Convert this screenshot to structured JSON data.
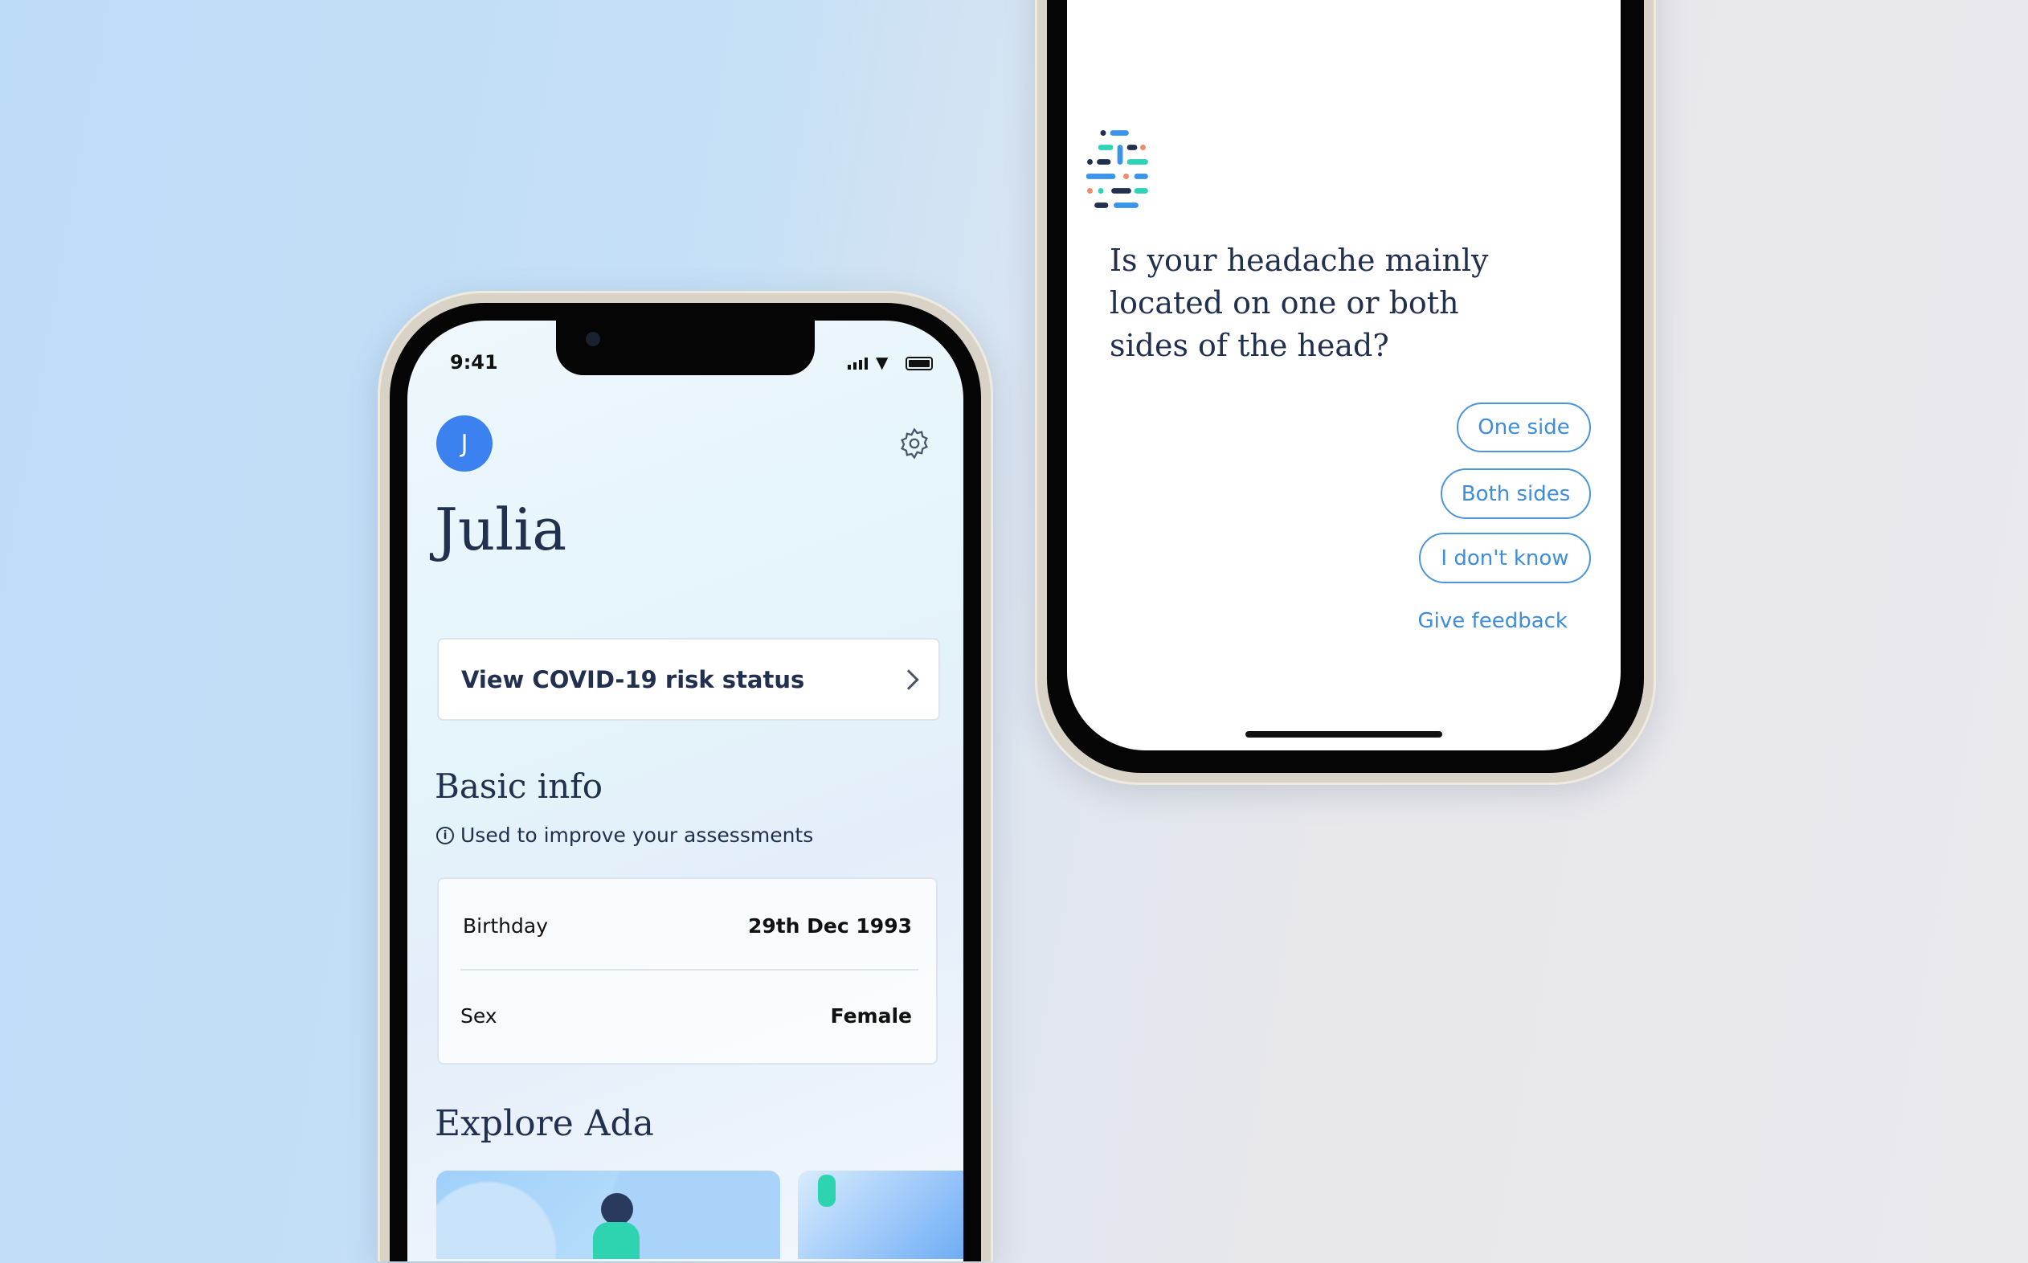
{
  "left_phone": {
    "status_bar": {
      "time": "9:41"
    },
    "avatar_initial": "J",
    "profile_name": "Julia",
    "covid_card": {
      "label": "View COVID-19 risk status"
    },
    "basic_info": {
      "title": "Basic info",
      "subtitle": "Used to improve your assessments",
      "rows": [
        {
          "label": "Birthday",
          "value": "29th Dec 1993"
        },
        {
          "label": "Sex",
          "value": "Female"
        }
      ]
    },
    "explore": {
      "title": "Explore Ada"
    }
  },
  "right_phone": {
    "question_lines": [
      "Is your headache mainly",
      "located on one or both",
      "sides of the head?"
    ],
    "answers": [
      "One side",
      "Both sides",
      "I don't know"
    ],
    "feedback_link": "Give feedback"
  },
  "colors": {
    "accent": "#3b82f0",
    "answer_blue": "#3e8ddb",
    "text_dark": "#22304f"
  }
}
